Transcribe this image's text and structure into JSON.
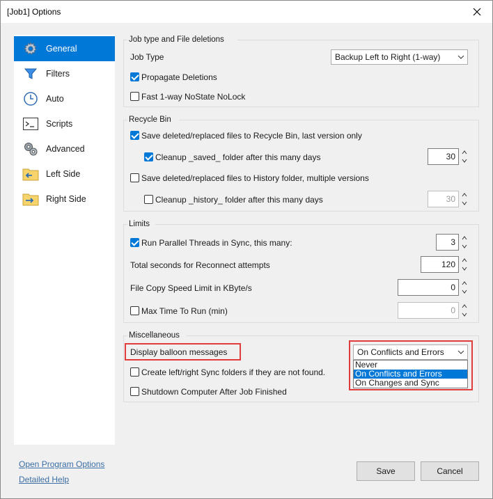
{
  "window": {
    "title": "[Job1] Options"
  },
  "sidebar": {
    "items": [
      {
        "label": "General",
        "icon": "gear-icon"
      },
      {
        "label": "Filters",
        "icon": "funnel-icon"
      },
      {
        "label": "Auto",
        "icon": "clock-icon"
      },
      {
        "label": "Scripts",
        "icon": "terminal-icon"
      },
      {
        "label": "Advanced",
        "icon": "gears-icon"
      },
      {
        "label": "Left Side",
        "icon": "folder-left-icon"
      },
      {
        "label": "Right Side",
        "icon": "folder-right-icon"
      }
    ],
    "active": "General"
  },
  "job_type_group": {
    "title": "Job type and File deletions",
    "job_type_label": "Job Type",
    "job_type_value": "Backup Left to Right (1-way)",
    "propagate_label": "Propagate Deletions",
    "propagate_checked": true,
    "fast_label": "Fast 1-way NoState NoLock",
    "fast_checked": false
  },
  "recycle_group": {
    "title": "Recycle Bin",
    "save_recycle_label": "Save deleted/replaced files to Recycle Bin, last version only",
    "save_recycle_checked": true,
    "cleanup_saved_label": "Cleanup _saved_ folder after this many days",
    "cleanup_saved_checked": true,
    "cleanup_saved_days": "30",
    "save_history_label": "Save deleted/replaced files to History folder, multiple versions",
    "save_history_checked": false,
    "cleanup_history_label": "Cleanup _history_ folder after this many days",
    "cleanup_history_checked": false,
    "cleanup_history_days": "30"
  },
  "limits_group": {
    "title": "Limits",
    "parallel_label": "Run Parallel Threads in Sync, this many:",
    "parallel_checked": true,
    "parallel_value": "3",
    "reconnect_label": "Total seconds for Reconnect attempts",
    "reconnect_value": "120",
    "speed_label": "File Copy Speed Limit in KByte/s",
    "speed_value": "0",
    "maxtime_label": "Max Time To Run (min)",
    "maxtime_checked": false,
    "maxtime_value": "0"
  },
  "misc_group": {
    "title": "Miscellaneous",
    "balloon_label": "Display balloon messages",
    "balloon_value": "On Conflicts and Errors",
    "balloon_options": [
      "Never",
      "On Conflicts and Errors",
      "On Changes and Sync"
    ],
    "create_label": "Create left/right Sync folders if they are not found.",
    "create_checked": false,
    "shutdown_label": "Shutdown Computer After Job Finished",
    "shutdown_checked": false
  },
  "footer": {
    "open_program_options": "Open Program Options",
    "detailed_help": "Detailed Help",
    "save": "Save",
    "cancel": "Cancel"
  },
  "colors": {
    "accent": "#0078d7",
    "highlight": "#e03c3c"
  }
}
